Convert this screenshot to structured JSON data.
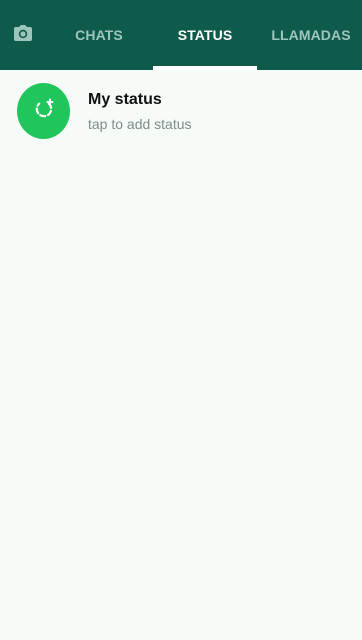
{
  "tabs": {
    "camera_icon": "camera-icon",
    "chats": "CHATS",
    "status": "STATUS",
    "calls": "LLAMADAS"
  },
  "status": {
    "title": "My status",
    "subtitle": "tap to add status",
    "avatar_icon": "add-status-icon"
  },
  "colors": {
    "toolbar": "#0f5b4b",
    "accent": "#20c65b",
    "inactive_tab": "#9ec5bc",
    "background": "#f6fbf7"
  }
}
